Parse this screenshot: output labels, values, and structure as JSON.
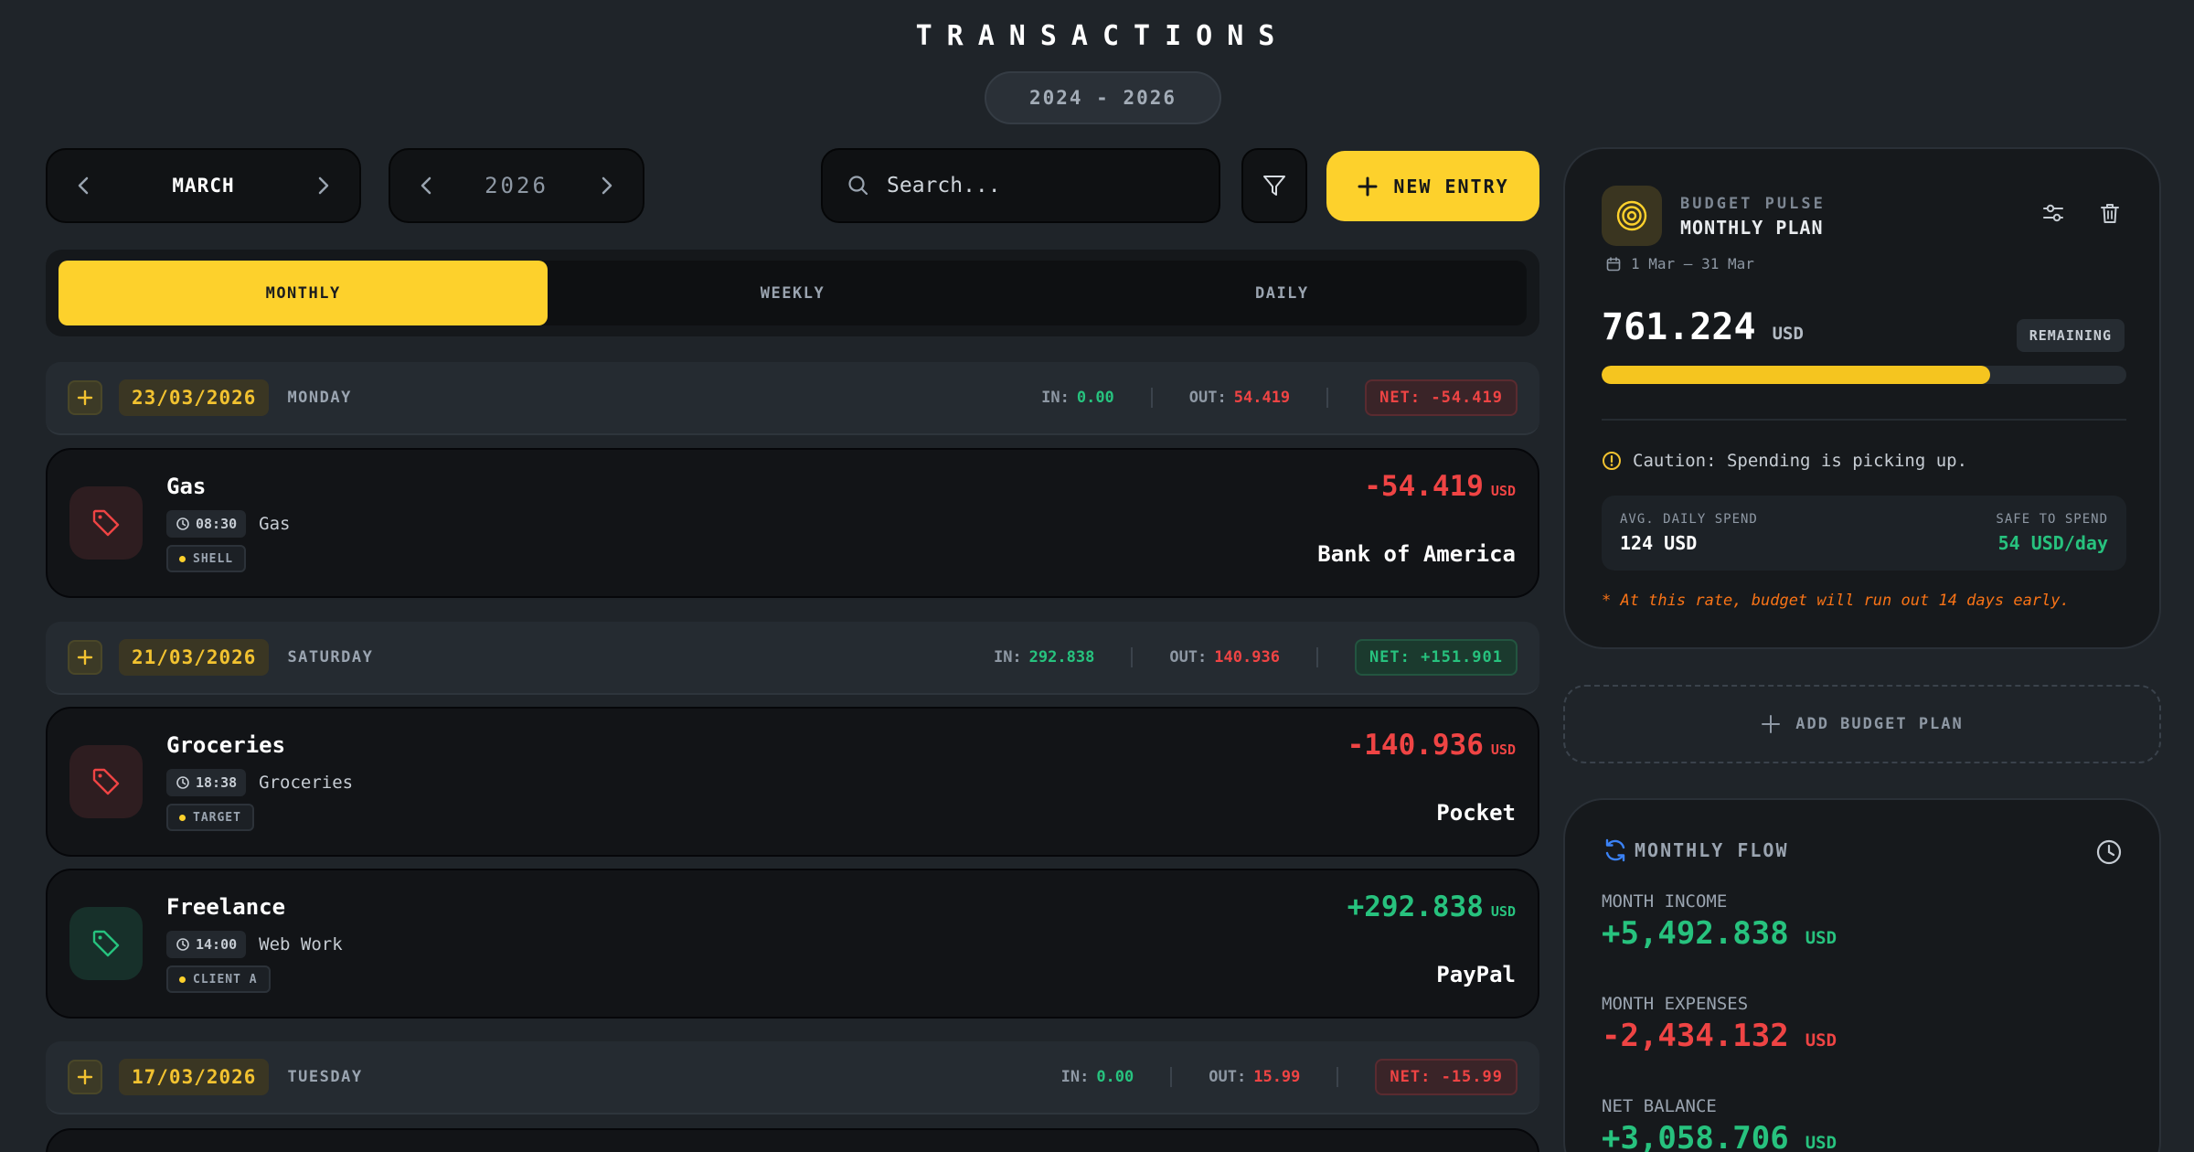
{
  "header": {
    "title": "TRANSACTIONS",
    "range": "2024 - 2026"
  },
  "toolbar": {
    "month": "MARCH",
    "year": "2026",
    "search_placeholder": "Search...",
    "new_entry_label": "NEW ENTRY"
  },
  "tabs": [
    {
      "label": "MONTHLY",
      "active": true
    },
    {
      "label": "WEEKLY",
      "active": false
    },
    {
      "label": "DAILY",
      "active": false
    }
  ],
  "days": [
    {
      "date": "23/03/2026",
      "weekday": "MONDAY",
      "in_label": "IN:",
      "in_value": "0.00",
      "out_label": "OUT:",
      "out_value": "54.419",
      "net": "NET: -54.419"
    },
    {
      "date": "21/03/2026",
      "weekday": "SATURDAY",
      "in_label": "IN:",
      "in_value": "292.838",
      "out_label": "OUT:",
      "out_value": "140.936",
      "net": "NET: +151.901"
    },
    {
      "date": "17/03/2026",
      "weekday": "TUESDAY",
      "in_label": "IN:",
      "in_value": "0.00",
      "out_label": "OUT:",
      "out_value": "15.99",
      "net": "NET: -15.99"
    }
  ],
  "transactions": [
    {
      "name": "Gas",
      "time": "08:30",
      "category": "Gas",
      "tag": "SHELL",
      "amount": "-54.419",
      "currency": "USD",
      "account": "Bank of America",
      "type": "expense",
      "icon": "tag-icon"
    },
    {
      "name": "Groceries",
      "time": "18:38",
      "category": "Groceries",
      "tag": "TARGET",
      "amount": "-140.936",
      "currency": "USD",
      "account": "Pocket",
      "type": "expense",
      "icon": "tag-icon"
    },
    {
      "name": "Freelance",
      "time": "14:00",
      "category": "Web Work",
      "tag": "CLIENT A",
      "amount": "+292.838",
      "currency": "USD",
      "account": "PayPal",
      "type": "income",
      "icon": "tag-icon"
    }
  ],
  "budget": {
    "kicker": "BUDGET PULSE",
    "plan": "MONTHLY PLAN",
    "dates": "1 Mar — 31 Mar",
    "remaining_amount": "761.224",
    "currency": "USD",
    "badge": "REMAINING",
    "progress_fraction": 0.74,
    "caution": "Caution: Spending is picking up.",
    "avg_label": "AVG. DAILY SPEND",
    "avg_value": "124 USD",
    "safe_label": "SAFE TO SPEND",
    "safe_value": "54 USD/day",
    "warning": "* At this rate, budget will run out 14 days early."
  },
  "add_plan_label": "ADD BUDGET PLAN",
  "flow": {
    "title": "MONTHLY FLOW",
    "income_label": "MONTH INCOME",
    "income_value": "+5,492.838",
    "expenses_label": "MONTH EXPENSES",
    "expenses_value": "-2,434.132",
    "net_label": "NET BALANCE",
    "net_value": "+3,058.706",
    "currency": "USD"
  },
  "colors": {
    "accent": "#fdd12c",
    "income": "#27c27e",
    "expense": "#ef4444",
    "background": "#1f2429"
  }
}
